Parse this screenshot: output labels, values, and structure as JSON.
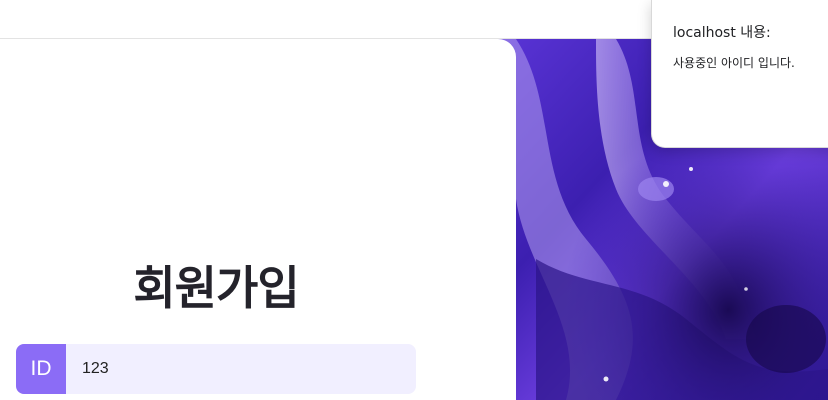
{
  "page": {
    "title": "회원가입"
  },
  "form": {
    "id_label": "ID",
    "id_value": "123"
  },
  "alert": {
    "title": "localhost 내용:",
    "message": "사용중인 아이디 입니다."
  },
  "colors": {
    "accent": "#8b6cf6",
    "input_bg": "#f1efff",
    "title_text": "#24232b",
    "hero_purple": "#4b2bd0"
  },
  "hero": {
    "icon": "purple-paint-swirl-image"
  }
}
